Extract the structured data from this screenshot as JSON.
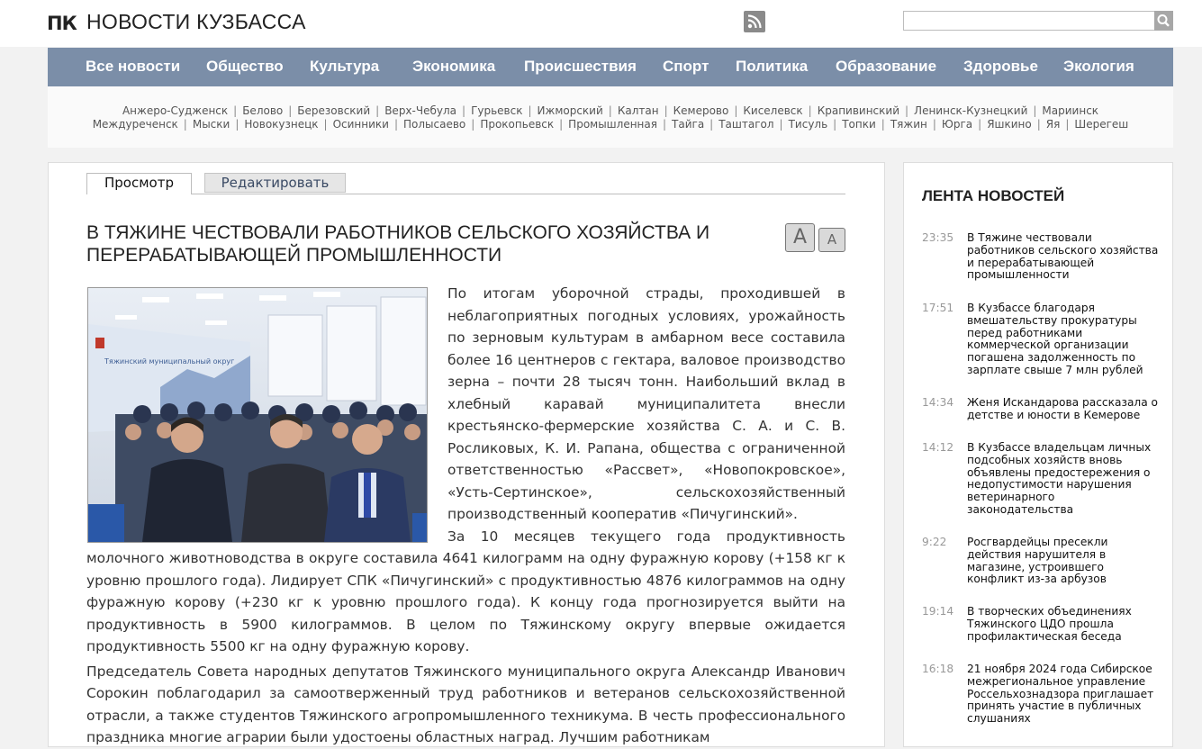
{
  "header": {
    "logo_mark": "ПК",
    "site_name": "НОВОСТИ КУЗБАССА",
    "search_placeholder": ""
  },
  "nav": {
    "items": [
      "Все новости",
      "Общество",
      "Культура",
      "Экономика",
      "Происшествия",
      "Спорт",
      "Политика",
      "Образование",
      "Здоровье",
      "Экология"
    ]
  },
  "cities": {
    "row1": [
      "Анжеро-Судженск",
      "Белово",
      "Березовский",
      "Верх-Чебула",
      "Гурьевск",
      "Ижморский",
      "Калтан",
      "Кемерово",
      "Киселевск",
      "Крапивинский",
      "Ленинск-Кузнецкий",
      "Мариинск"
    ],
    "row2": [
      "Междуреченск",
      "Мыски",
      "Новокузнецк",
      "Осинники",
      "Полысаево",
      "Прокопьевск",
      "Промышленная",
      "Тайга",
      "Таштагол",
      "Тисуль",
      "Топки",
      "Тяжин",
      "Юрга",
      "Яшкино",
      "Яя",
      "Шерегеш"
    ]
  },
  "tabs": {
    "view": "Просмотр",
    "edit": "Редактировать"
  },
  "article": {
    "title": "В Тяжине чествовали работников сельского хозяйства и перерабатывающей промышленности",
    "font_up": "A",
    "font_down": "A",
    "p1": "По итогам уборочной страды, проходившей в неблагоприятных погодных условиях, урожайность по зерновым культурам в амбарном весе составила более 16 центнеров с гектара, валовое производство зерна – почти 28 тысяч тонн. Наибольший вклад в хлебный каравай муниципалитета внесли крестьянско-фермерские хозяйства С. А. и С. В. Росликовых, К. И. Рапана, общества с ограниченной ответственностью «Рассвет», «Новопокровское», «Усть-Сертинское», сельскохозяйственный производственный кооператив «Пичугинский».",
    "p2": "За 10 месяцев текущего года продуктивность молочного животноводства в округе составила 4641 килограмм на одну фуражную корову (+158 кг к уровню прошлого года). Лидирует СПК «Пичугинский» с продуктивностью 4876 килограммов на одну фуражную корову (+230 кг к уровню прошлого года). К концу года прогнозируется выйти на продуктивность в 5900 килограммов. В целом по Тяжинскому округу впервые ожидается продуктивность 5500 кг на одну фуражную корову.",
    "p3": "Председатель Совета народных депутатов Тяжинского муниципального округа Александр Иванович Сорокин поблагодарил за самоотверженный труд работников и ветеранов сельскохозяйственной отрасли, а также студентов Тяжинского агропромышленного техникума. В честь профессионального праздника многие аграрии были удостоены областных наград. Лучшим работникам",
    "photo_banner": "Тяжинский муниципальный округ"
  },
  "sidebar": {
    "title": "ЛЕНТА НОВОСТЕЙ",
    "items": [
      {
        "time": "23:35",
        "text": "В Тяжине чествовали работников сельского хозяйства и перерабатывающей промышленности"
      },
      {
        "time": "17:51",
        "text": "В Кузбассе благодаря вмешательству прокуратуры перед работниками коммерческой организации погашена задолженность по зарплате свыше 7 млн рублей"
      },
      {
        "time": "14:34",
        "text": "Женя Искандарова рассказала о детстве и юности в Кемерове"
      },
      {
        "time": "14:12",
        "text": "В Кузбассе владельцам личных подсобных хозяйств вновь объявлены предостережения о недопустимости нарушения ветеринарного законодательства"
      },
      {
        "time": "9:22",
        "text": "Росгвардейцы пресекли действия нарушителя в магазине, устроившего конфликт из-за арбузов"
      },
      {
        "time": "19:14",
        "text": "В творческих объединениях Тяжинского ЦДО прошла профилактическая беседа"
      },
      {
        "time": "16:18",
        "text": "21 ноября 2024 года Сибирское межрегиональное управление Россельхознадзора приглашает принять участие в публичных слушаниях"
      }
    ]
  }
}
